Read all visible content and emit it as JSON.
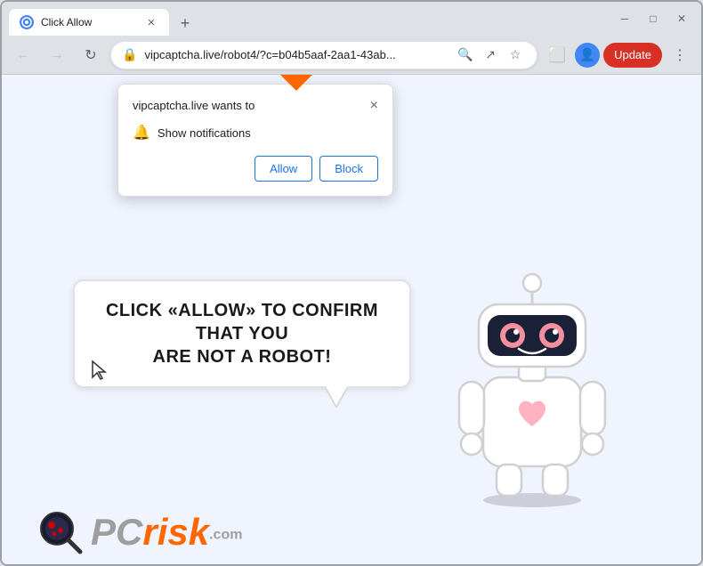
{
  "browser": {
    "title": "Click Allow",
    "tab": {
      "title": "Click Allow",
      "favicon": "globe"
    },
    "url": "vipcaptcha.live/robot4/?c=b04b5aaf-2aa1-43ab...",
    "url_full": "vipcaptcha.live/robot4/?c=b04b5aaf-2aa1-43ab...",
    "update_btn": "Update",
    "nav": {
      "back": "←",
      "forward": "→",
      "reload": "↻"
    }
  },
  "notification_popup": {
    "title": "vipcaptcha.live wants to",
    "notification_label": "Show notifications",
    "allow_btn": "Allow",
    "block_btn": "Block",
    "close_btn": "×"
  },
  "page": {
    "bubble_text_line1": "CLICK «ALLOW» TO CONFIRM THAT YOU",
    "bubble_text_line2": "ARE NOT A ROBOT!"
  },
  "logo": {
    "pc": "PC",
    "risk": "risk",
    "com": ".com"
  },
  "icons": {
    "lock": "🔒",
    "bell": "🔔",
    "search": "🔍",
    "share": "↗",
    "bookmark": "☆",
    "extensions": "⬜",
    "profile": "👤",
    "menu": "⋮",
    "minimize": "─",
    "maximize": "□",
    "close_win": "✕",
    "close_tab": "✕",
    "new_tab": "+"
  }
}
